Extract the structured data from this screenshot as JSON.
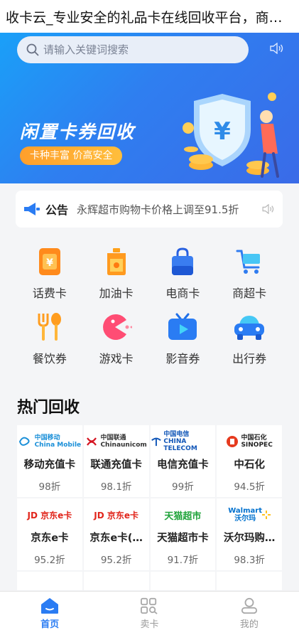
{
  "page": {
    "title": "收卡云_专业安全的礼品卡在线回收平台，商务卡、加油卡、购物卡回收"
  },
  "banner": {
    "search_placeholder": "请输入关键词搜索",
    "headline": "闲置卡券回收",
    "tagline": "卡种丰富 价高安全"
  },
  "notice": {
    "label": "公告",
    "text": "永辉超市购物卡价格上调至91.5折"
  },
  "categories": [
    {
      "label": "话费卡",
      "icon": "phone-card-icon"
    },
    {
      "label": "加油卡",
      "icon": "fuel-can-icon"
    },
    {
      "label": "电商卡",
      "icon": "shopping-bag-icon"
    },
    {
      "label": "商超卡",
      "icon": "cart-icon"
    },
    {
      "label": "餐饮券",
      "icon": "fork-spoon-icon"
    },
    {
      "label": "游戏卡",
      "icon": "pacman-icon"
    },
    {
      "label": "影音券",
      "icon": "tv-play-icon"
    },
    {
      "label": "出行券",
      "icon": "car-icon"
    }
  ],
  "hot": {
    "title": "热门回收",
    "cards": [
      {
        "brand": "中国移动 China Mobile",
        "name": "移动充值卡",
        "discount": "98折"
      },
      {
        "brand": "中国联通 Chinaunicom",
        "name": "联通充值卡",
        "discount": "98.1折"
      },
      {
        "brand": "中国电信 CHINA TELECOM",
        "name": "电信充值卡",
        "discount": "99折"
      },
      {
        "brand": "中国石化 SINOPEC",
        "name": "中石化",
        "discount": "94.5折"
      },
      {
        "brand": "JD京东e卡",
        "name": "京东e卡",
        "discount": "95.2折"
      },
      {
        "brand": "JD京东e卡",
        "name": "京东e卡(…",
        "discount": "95.2折"
      },
      {
        "brand": "天猫超市",
        "name": "天猫超市卡",
        "discount": "91.7折"
      },
      {
        "brand": "Walmart 沃尔玛",
        "name": "沃尔玛购…",
        "discount": "98.3折"
      }
    ]
  },
  "tabs": [
    {
      "label": "首页",
      "active": true
    },
    {
      "label": "卖卡",
      "active": false
    },
    {
      "label": "我的",
      "active": false
    }
  ],
  "colors": {
    "accent": "#2a7cf3",
    "orange": "#ff9f2b"
  }
}
